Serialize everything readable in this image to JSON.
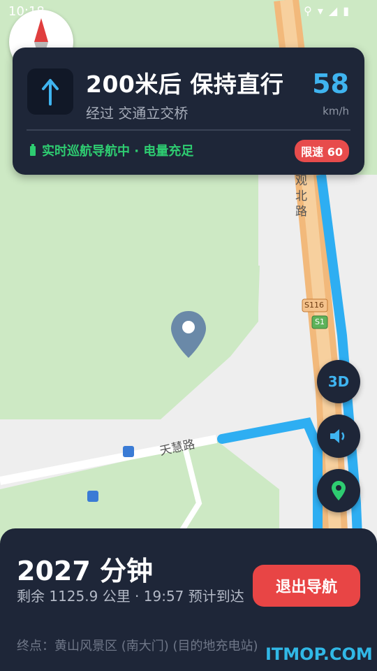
{
  "status_bar": {
    "time": "10:18"
  },
  "navigation": {
    "instruction": "200米后 保持直行",
    "via": "经过 交通立交桥",
    "speed": "58",
    "speed_unit": "km/h",
    "status_text": "实时巡航导航中 · 电量充足",
    "speed_limit": "限速 60"
  },
  "map": {
    "road_vertical_label": "观北路",
    "road_horizontal_label": "天慧路",
    "shield_s116": "S116",
    "shield_s1": "S1"
  },
  "controls": {
    "mode_3d": "3D"
  },
  "trip": {
    "duration": "2027 分钟",
    "remaining": "剩余 1125.9 公里 · 19:57 预计到达",
    "destination": "终点：黄山风景区 (南大门) (目的地充电站)",
    "exit_label": "退出导航"
  },
  "watermark": "ITMOP.COM",
  "colors": {
    "card_bg": "#1e2638",
    "accent_blue": "#3fb4f0",
    "accent_green": "#2ecc71",
    "danger_red": "#e84545"
  }
}
